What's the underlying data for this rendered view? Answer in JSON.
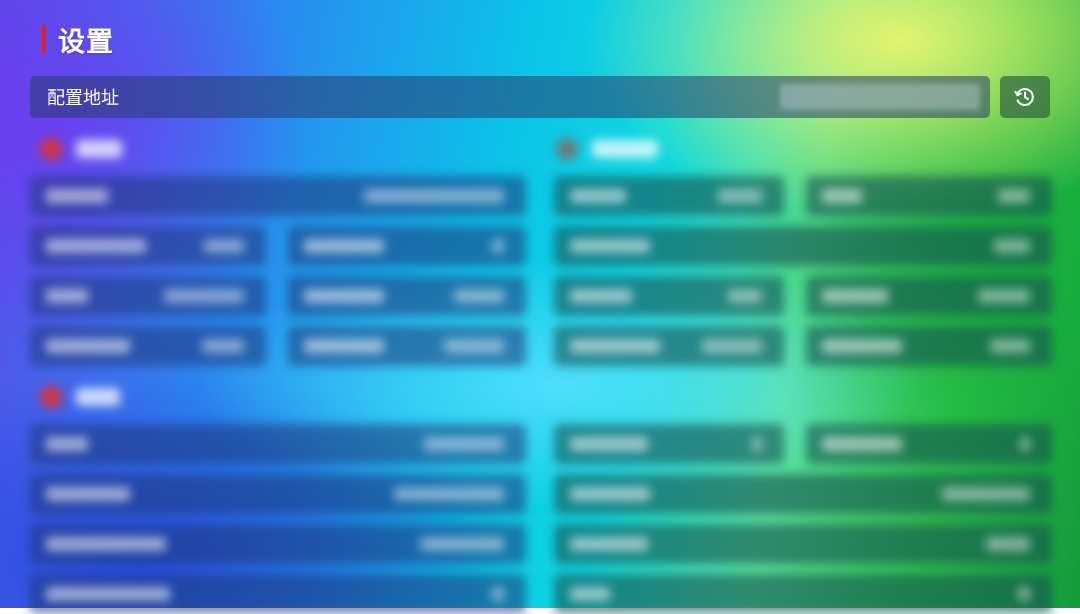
{
  "header": {
    "title": "设置"
  },
  "config": {
    "label": "配置地址"
  },
  "toolbar": {
    "history_icon": "history-icon"
  },
  "colors": {
    "accent": "#e01f2d"
  }
}
